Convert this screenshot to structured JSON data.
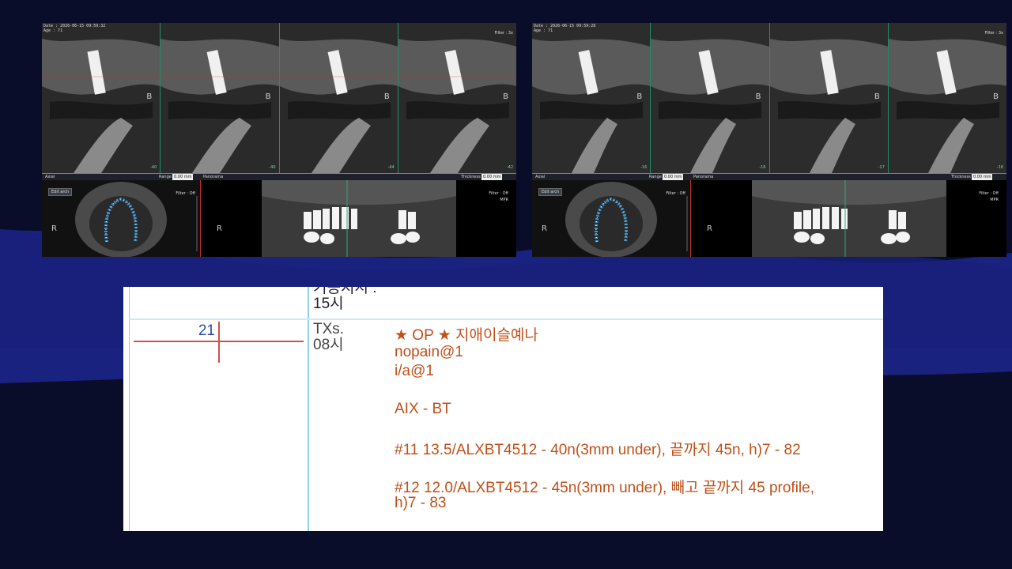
{
  "viewers": [
    {
      "id": "left",
      "date": "Date : 2026-06-15 09:59:32",
      "age": "Age : 71",
      "filter": "Filter : 3x",
      "slice_numbers": [
        "-40",
        "-40",
        "-44",
        "-42"
      ],
      "toolbar": {
        "axial": "Axial",
        "range": "Range",
        "range_value": "0.00 mm",
        "panorama": "Panorama",
        "thickness": "Thickness",
        "thickness_value": "0.00 mm"
      },
      "edit_arch": "Edit arch",
      "filter_off": "Filter : Off",
      "mpr": "MPR",
      "r_label": "R",
      "b_label": "B"
    },
    {
      "id": "right",
      "date": "Date : 2026-06-15 09:59:28",
      "age": "Age : 71",
      "filter": "Filter : 3x",
      "slice_numbers": [
        "-16",
        "-16",
        "-17",
        "-16"
      ],
      "toolbar": {
        "axial": "Axial",
        "range": "Range",
        "range_value": "0.00 mm",
        "panorama": "Panorama",
        "thickness": "Thickness",
        "thickness_value": "0.00 mm"
      },
      "edit_arch": "Edit arch",
      "filter_off": "Filter : Off",
      "mpr": "MPR",
      "r_label": "R",
      "b_label": "B"
    }
  ],
  "notes": {
    "prev_time_line1": "기공지시 :",
    "prev_time_line2": "15시",
    "tooth_number": "21",
    "txs_label": "TXs.",
    "txs_time": "08시",
    "lines": [
      "★   OP   ★  지애이슬예나",
      "nopain@1",
      "i/a@1",
      "AIX - BT",
      "#11 13.5/ALXBT4512 - 40n(3mm under), 끝까지  45n, h)7 - 82",
      "#12 12.0/ALXBT4512 - 45n(3mm under), 빼고  끝까지  45 profile,",
      "h)7 - 83"
    ]
  },
  "colors": {
    "background": "#0a0d2a",
    "wave": "#1a2280",
    "accent_green": "#2fa87c",
    "implant_blue": "#3a9ad8",
    "note_text": "#c0501a",
    "tooth_number": "#2a4aa8",
    "cross_line": "#d05050"
  }
}
